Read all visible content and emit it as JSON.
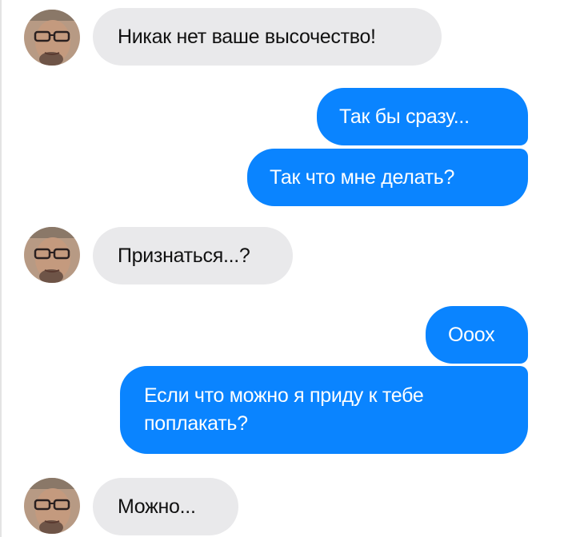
{
  "colors": {
    "incoming_bubble": "#e9e9eb",
    "outgoing_bubble": "#0a84ff",
    "incoming_text": "#111111",
    "outgoing_text": "#ffffff"
  },
  "avatar_icon": "person-photo",
  "messages": [
    {
      "sender": "them",
      "text": "Никак нет ваше высочество!"
    },
    {
      "sender": "me",
      "text": "Так бы сразу..."
    },
    {
      "sender": "me",
      "text": "Так что мне делать?"
    },
    {
      "sender": "them",
      "text": "Признаться...?"
    },
    {
      "sender": "me",
      "text": "Ооох"
    },
    {
      "sender": "me",
      "text": "Если что можно я приду к тебе поплакать?"
    },
    {
      "sender": "them",
      "text": "Можно..."
    }
  ]
}
